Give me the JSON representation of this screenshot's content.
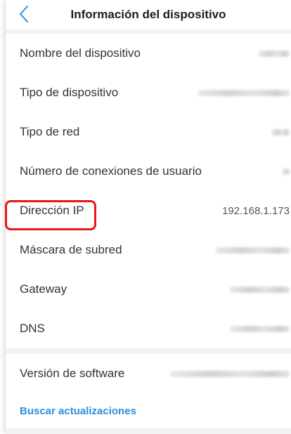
{
  "header": {
    "title": "Información del dispositivo"
  },
  "rows": [
    {
      "label": "Nombre del dispositivo",
      "value": null
    },
    {
      "label": "Tipo de dispositivo",
      "value": null
    },
    {
      "label": "Tipo de red",
      "value": null
    },
    {
      "label": "Número de conexiones de usuario",
      "value": null
    },
    {
      "label": "Dirección IP",
      "value": "192.168.1.173"
    },
    {
      "label": "Máscara de subred",
      "value": null
    },
    {
      "label": "Gateway",
      "value": null
    },
    {
      "label": "DNS",
      "value": null
    }
  ],
  "software": {
    "label": "Versión de software",
    "value": null
  },
  "update_link": "Buscar actualizaciones",
  "colors": {
    "accent": "#2a8fe0",
    "highlight": "#e8151b"
  },
  "icons": {
    "back": "chevron-left-icon"
  }
}
